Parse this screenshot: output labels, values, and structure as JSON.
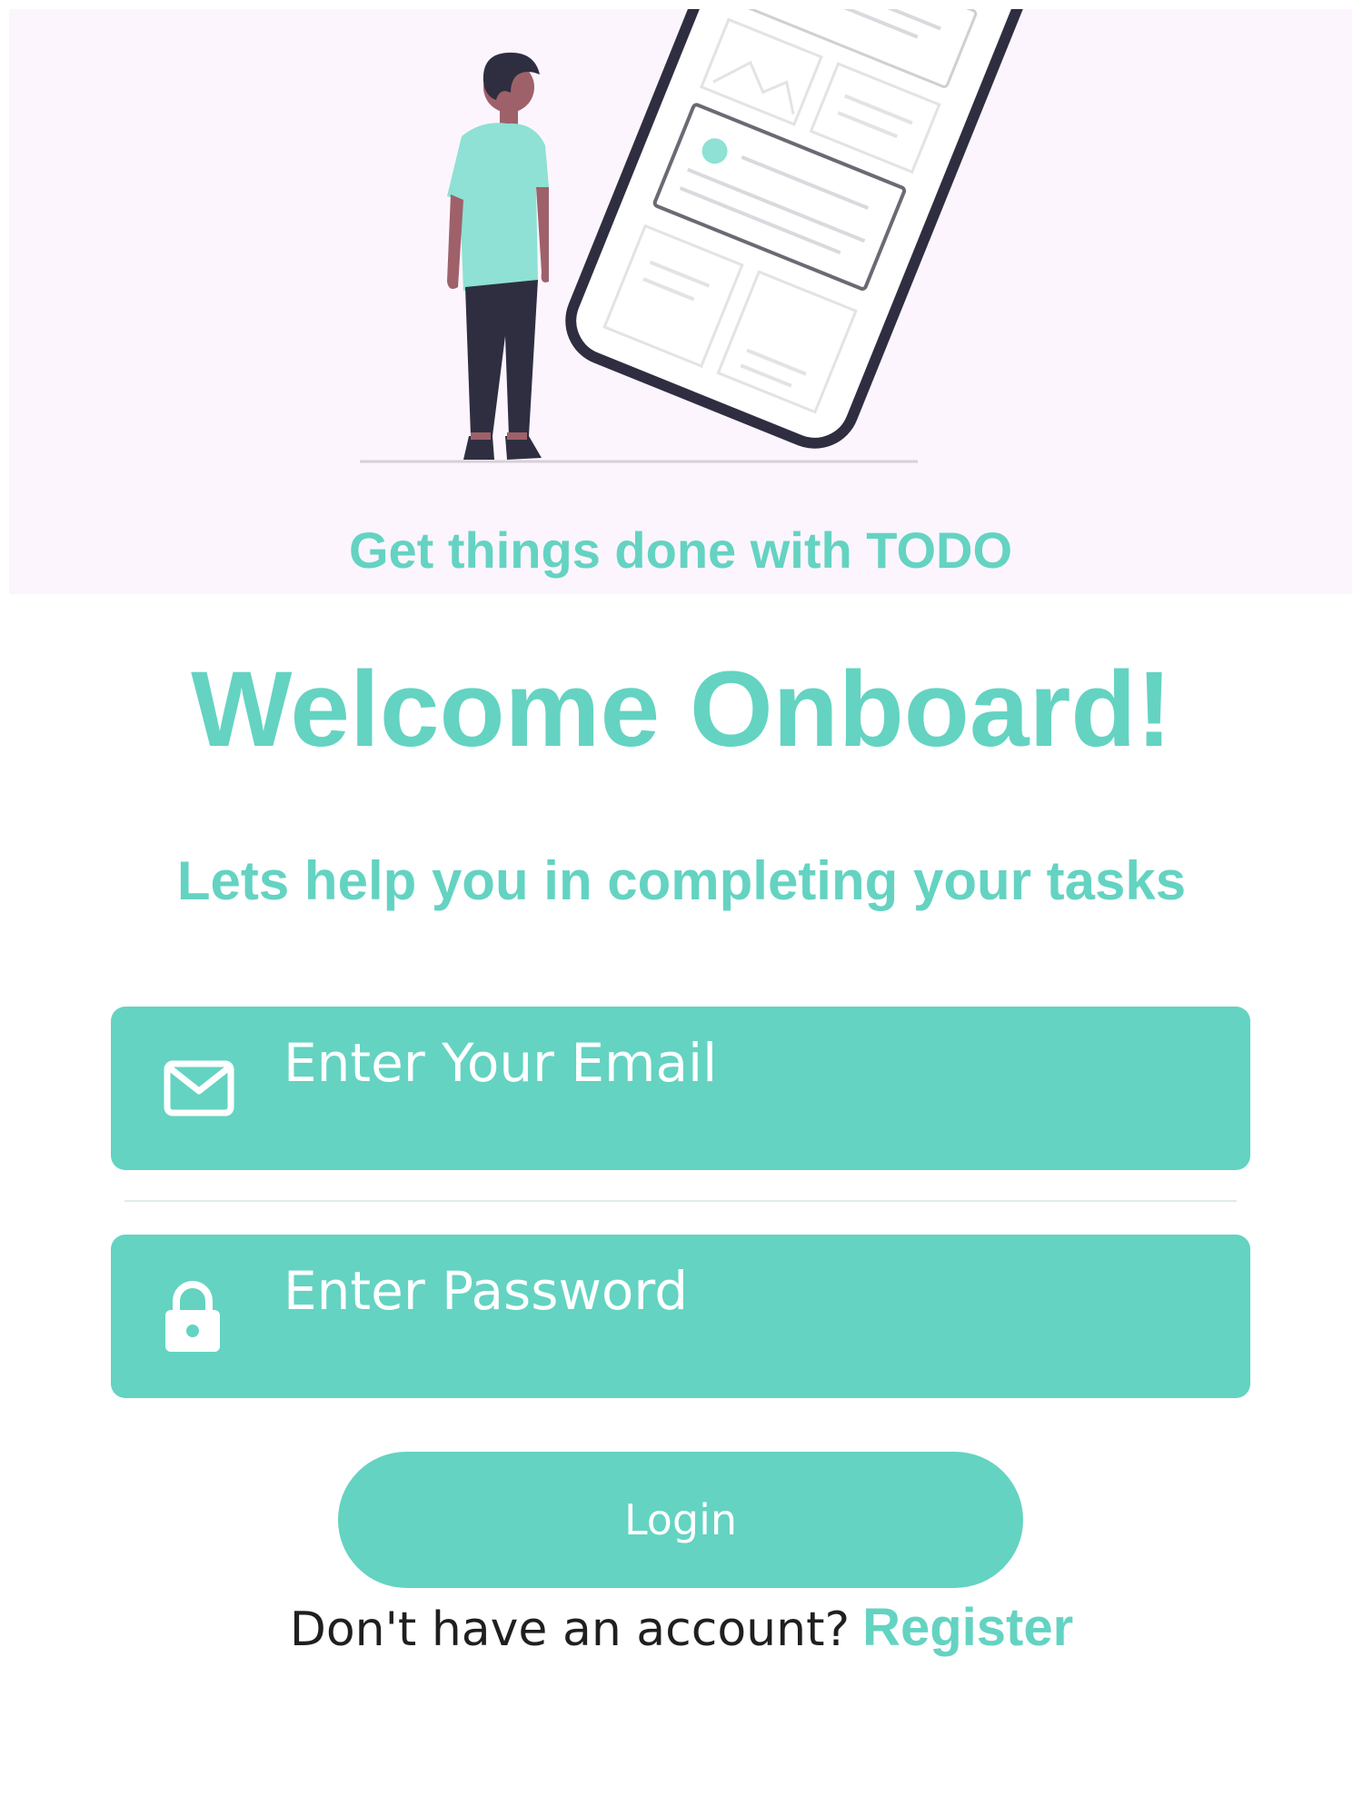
{
  "hero": {
    "caption": "Get things done with TODO",
    "illustration": "person-with-phone-illustration"
  },
  "welcome": {
    "title": "Welcome Onboard!",
    "subtitle": "Lets help you in completing your tasks"
  },
  "form": {
    "email": {
      "placeholder": "Enter Your Email",
      "value": "",
      "icon": "envelope-icon"
    },
    "password": {
      "placeholder": "Enter Password",
      "value": "",
      "icon": "lock-icon"
    },
    "login_label": "Login"
  },
  "footer": {
    "prompt": "Don't have an account?",
    "register_label": "Register"
  },
  "colors": {
    "accent": "#64d3c2",
    "hero_background": "#fcf5fd",
    "illustration_teal": "#8ee1d4",
    "illustration_dark": "#2f2e41",
    "skin": "#9e616a"
  }
}
